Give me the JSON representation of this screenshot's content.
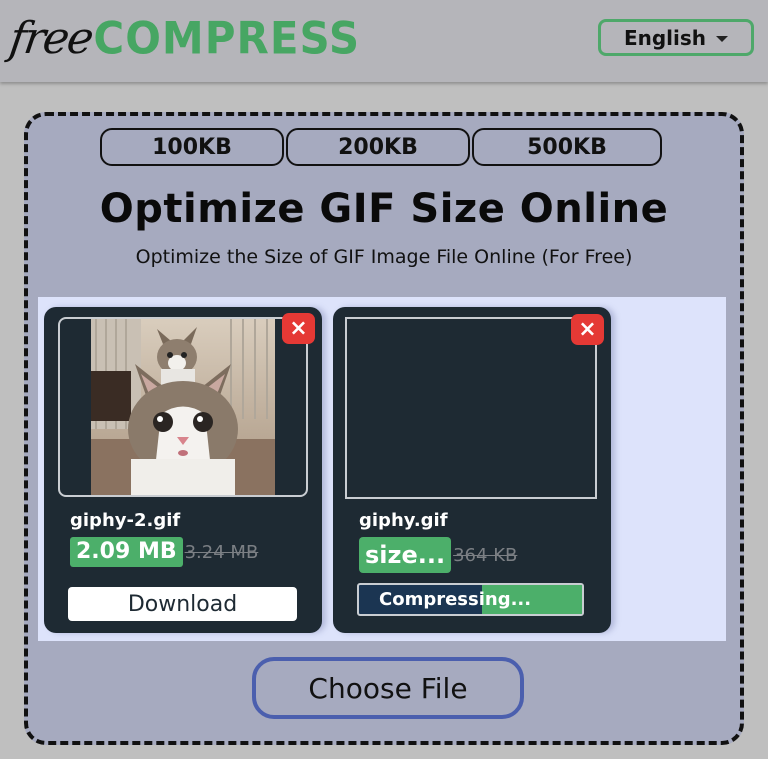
{
  "header": {
    "logo_prefix": "free",
    "logo_main": "COMPRESS",
    "language": "English"
  },
  "presets": [
    "100KB",
    "200KB",
    "500KB"
  ],
  "main": {
    "title": "Optimize GIF Size Online",
    "subtitle": "Optimize the Size of GIF Image File Online (For Free)",
    "choose_file_label": "Choose File"
  },
  "files": [
    {
      "name": "giphy-2.gif",
      "new_size": "2.09 MB",
      "original_size": "3.24 MB",
      "status": "done",
      "action_label": "Download",
      "close_icon": "×"
    },
    {
      "name": "giphy.gif",
      "new_size": "size...",
      "original_size": "364 KB",
      "status": "compressing",
      "progress_label": "Compressing...",
      "progress_percent": 45,
      "close_icon": "×"
    }
  ],
  "colors": {
    "brand_green": "#47a663",
    "close_red": "#e53935",
    "card_bg": "#1e2a33",
    "choose_border": "#4b5fae"
  }
}
